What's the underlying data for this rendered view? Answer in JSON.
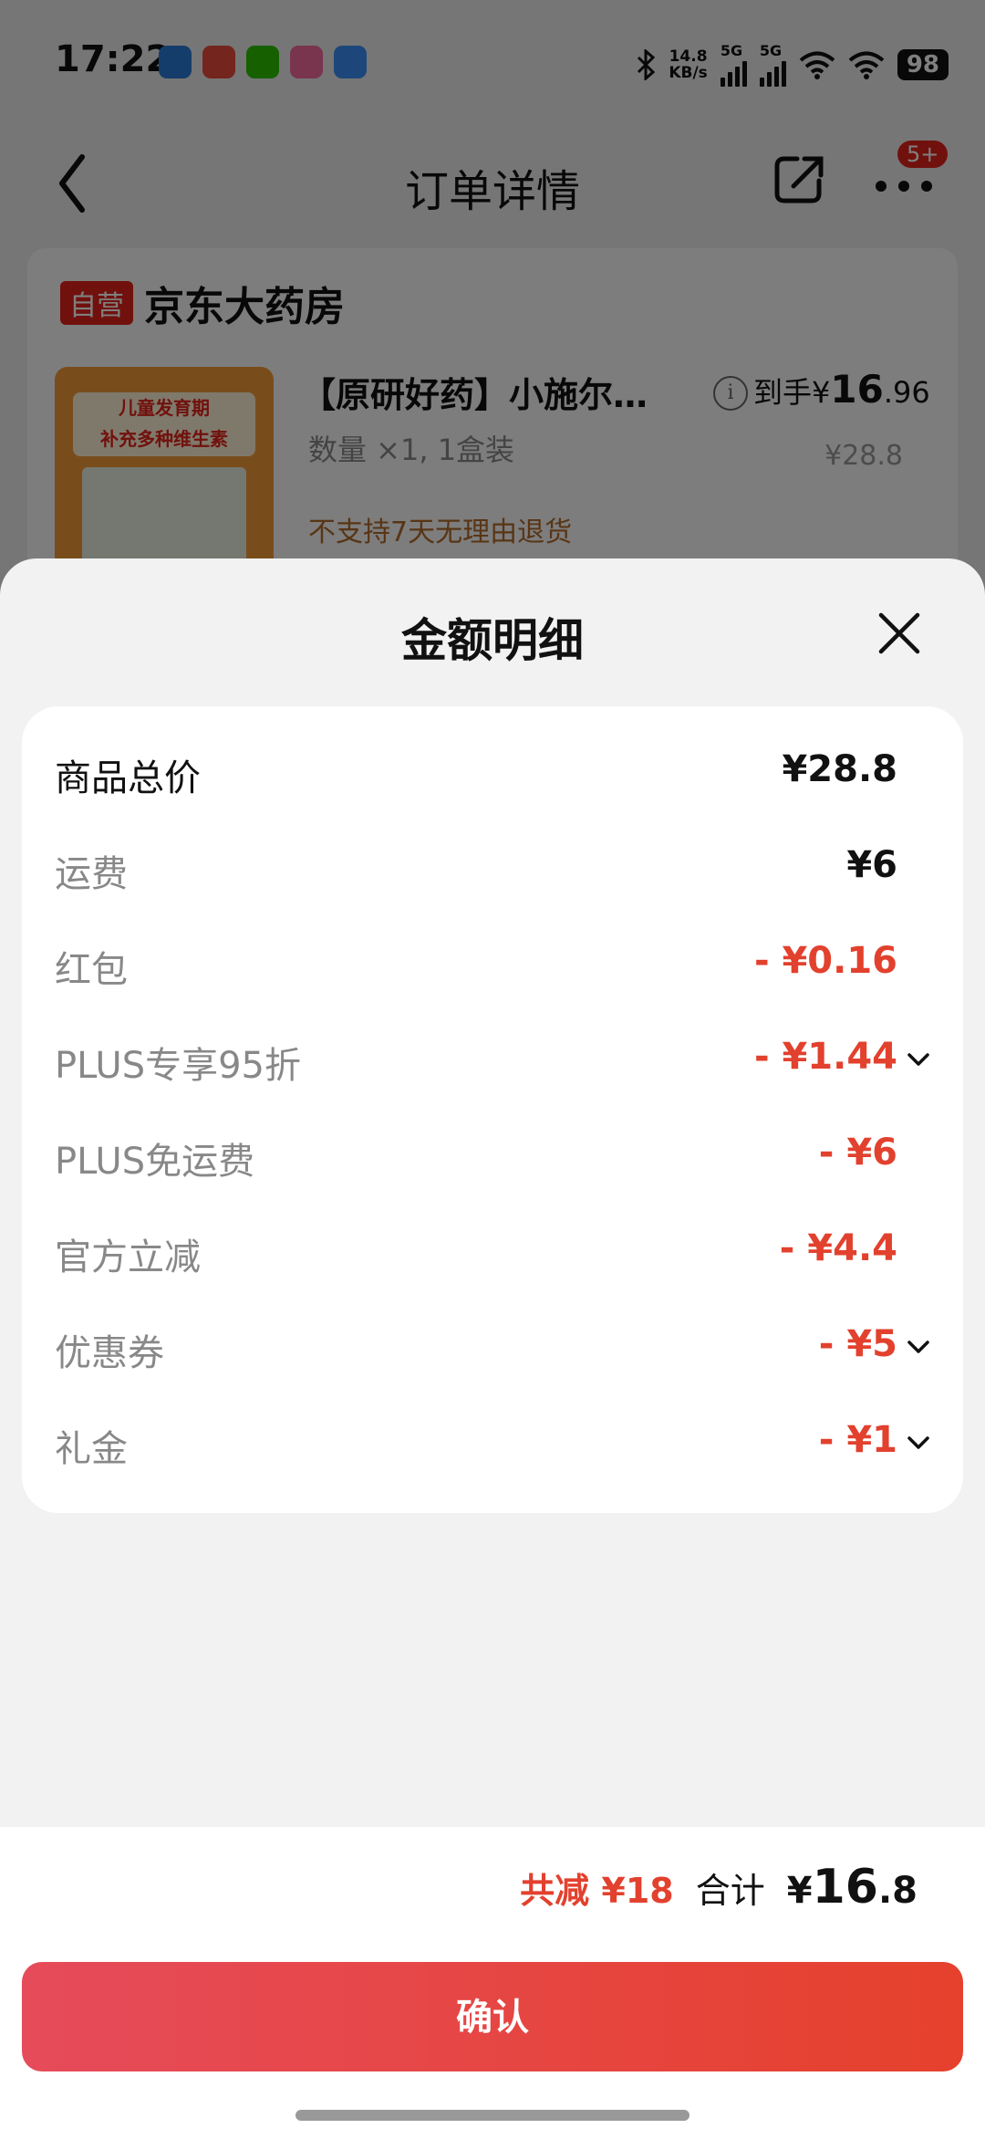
{
  "status_bar": {
    "time": "17:22",
    "speed_top": "14.8",
    "speed_bottom": "KB/s",
    "net1": "5G",
    "net2": "5G",
    "battery": "98"
  },
  "nav": {
    "title": "订单详情",
    "badge": "5+"
  },
  "store": {
    "tag": "自营",
    "name": "京东大药房"
  },
  "product": {
    "title": "【原研好药】小施尔…",
    "quantity": "数量 ×1, 1盒装",
    "note": "不支持7天无理由退货",
    "banner_line1": "儿童发育期",
    "banner_line2": "补充多种维生素",
    "final_price_prefix": "到手¥",
    "final_price_int": "16",
    "final_price_dec": ".96",
    "original_price": "¥28.8"
  },
  "sheet": {
    "title": "金额明细",
    "rows": [
      {
        "label": "商品总价",
        "value": "¥28.8"
      },
      {
        "label": "运费",
        "value": "¥6"
      },
      {
        "label": "红包",
        "value": "- ¥0.16"
      },
      {
        "label": "PLUS专享95折",
        "value": "- ¥1.44"
      },
      {
        "label": "PLUS免运费",
        "value": "- ¥6"
      },
      {
        "label": "官方立减",
        "value": "- ¥4.4"
      },
      {
        "label": "优惠券",
        "value": "- ¥5"
      },
      {
        "label": "礼金",
        "value": "- ¥1"
      }
    ]
  },
  "footer": {
    "reduce": "共减 ¥18",
    "total_label": "合计",
    "total_prefix": "¥",
    "total_int": "16",
    "total_dec": ".8",
    "confirm": "确认"
  },
  "colors": {
    "accent_red": "#e2412e",
    "button_gradient_start": "#e64b5a",
    "button_gradient_end": "#e6412d"
  }
}
